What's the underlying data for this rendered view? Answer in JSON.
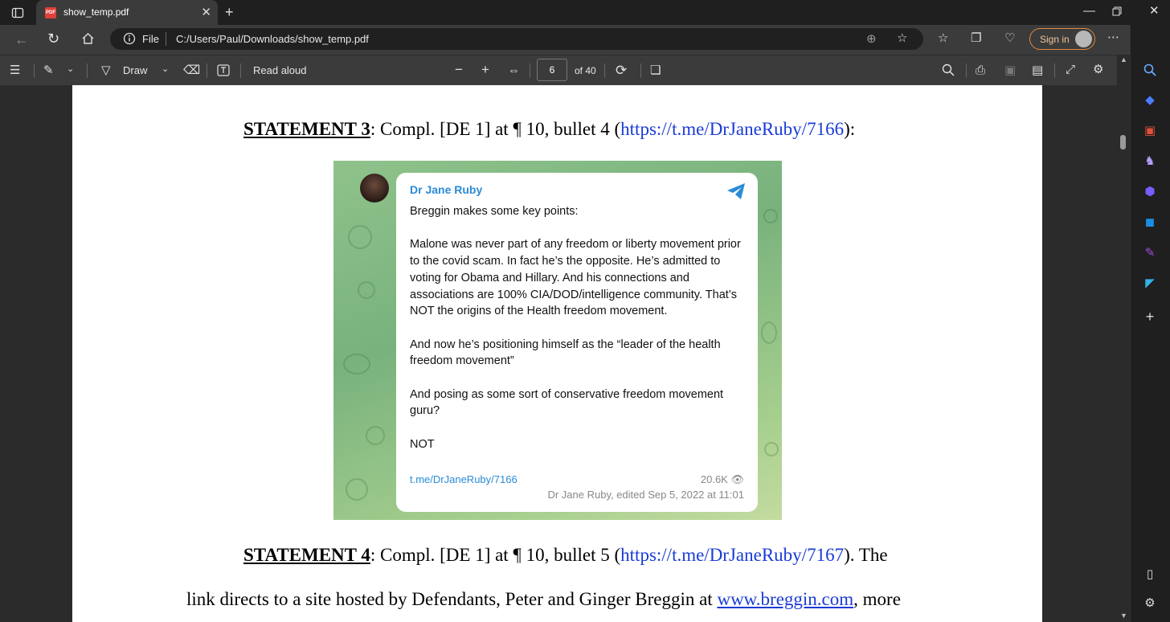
{
  "browser": {
    "tab_title": "show_temp.pdf",
    "address_prefix": "File",
    "address_url": "C:/Users/Paul/Downloads/show_temp.pdf",
    "signin_label": "Sign in"
  },
  "pdf_toolbar": {
    "draw_label": "Draw",
    "read_aloud_label": "Read aloud",
    "current_page": "6",
    "page_total": "of 40"
  },
  "document": {
    "statement3": {
      "heading": "STATEMENT 3",
      "text_before_link": ": Compl. [DE 1] at ¶ 10, bullet 4 (",
      "link": "https://t.me/DrJaneRuby/7166",
      "text_after_link": "):"
    },
    "statement4": {
      "heading": "STATEMENT 4",
      "text_before_link": ": Compl. [DE 1] at ¶ 10, bullet 5 (",
      "link": "https://t.me/DrJaneRuby/7167",
      "text_after_link": "). The"
    },
    "line3": {
      "text_before_link": "link directs to a site hosted by Defendants, Peter and Ginger Breggin at ",
      "link": "www.breggin.com",
      "text_after_link": ", more"
    }
  },
  "telegram_post": {
    "author": "Dr Jane Ruby",
    "paragraphs": [
      "Breggin makes some key points:",
      "Malone was never part of any freedom or liberty movement prior to the covid scam. In fact he’s the opposite. He’s admitted to voting for Obama and Hillary. And his connections and associations are 100% CIA/DOD/intelligence community. That’s NOT the origins of the Health freedom movement.",
      "And now he’s positioning himself as the “leader of the health freedom movement”",
      "And posing as some sort of conservative freedom movement guru?",
      "NOT"
    ],
    "link": "t.me/DrJaneRuby/7166",
    "views": "20.6K",
    "meta": "Dr Jane Ruby, edited  Sep 5, 2022 at 11:01",
    "accent": "#2a8bd6"
  }
}
